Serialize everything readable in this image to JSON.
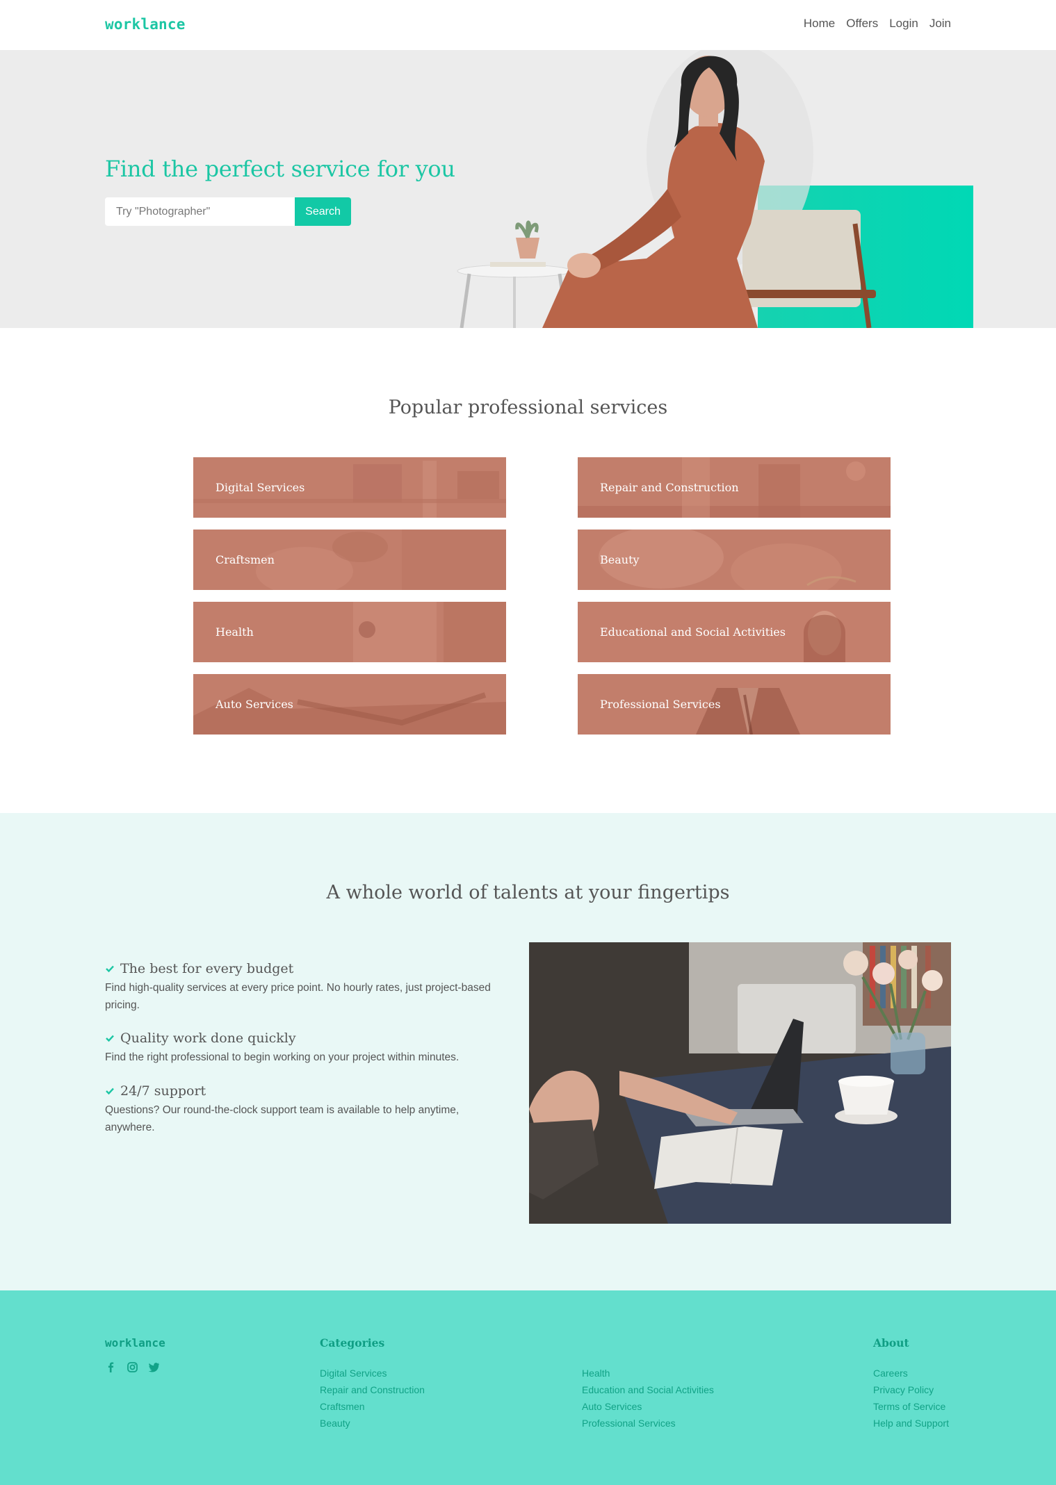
{
  "brand": {
    "name": "worklance",
    "accent": "#1cc6a4",
    "footer_bg": "#63dfcd",
    "tile_tint": "#c27e6b"
  },
  "nav": {
    "items": [
      "Home",
      "Offers",
      "Login",
      "Join"
    ]
  },
  "hero": {
    "title": "Find the perfect service for you",
    "search_placeholder": "Try \"Photographer\"",
    "search_button": "Search"
  },
  "popular": {
    "title": "Popular professional services",
    "services": [
      "Digital Services",
      "Repair and Construction",
      "Craftsmen",
      "Beauty",
      "Health",
      "Educational and Social Activities",
      "Auto Services",
      "Professional Services"
    ]
  },
  "talents": {
    "title": "A whole world of talents at your fingertips",
    "features": [
      {
        "title": "The best for every budget",
        "text": "Find high-quality services at every price point. No hourly rates, just project-based pricing."
      },
      {
        "title": "Quality work done quickly",
        "text": "Find the right professional to begin working on your project within minutes."
      },
      {
        "title": "24/7 support",
        "text": "Questions? Our round-the-clock support team is available to help anytime, anywhere."
      }
    ]
  },
  "footer": {
    "logo": "worklance",
    "socials": [
      "facebook-icon",
      "instagram-icon",
      "twitter-icon"
    ],
    "categories_heading": "Categories",
    "categories_col1": [
      "Digital Services",
      "Repair and Construction",
      "Craftsmen",
      "Beauty"
    ],
    "categories_col2": [
      "Health",
      "Education and Social Activities",
      "Auto Services",
      "Professional Services"
    ],
    "about_heading": "About",
    "about_links": [
      "Careers",
      "Privacy Policy",
      "Terms of Service",
      "Help and Support"
    ]
  }
}
